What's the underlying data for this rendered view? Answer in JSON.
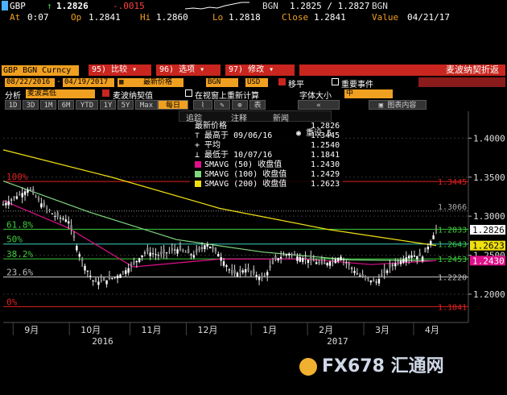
{
  "quote": {
    "ticker": "GBP",
    "arrow": "↑",
    "last": "1.2826",
    "change": "-.0015",
    "source_label": "BGN",
    "bid_ask": "1.2825 / 1.2827",
    "source_label2": "BGN",
    "at_label": "At",
    "at_value": "0:07",
    "op_label": "Op",
    "op_value": "1.2841",
    "hi_label": "Hi",
    "hi_value": "1.2860",
    "lo_label": "Lo",
    "lo_value": "1.2818",
    "close_label": "Close",
    "close_value": "1.2841",
    "value_label": "Value",
    "value_date": "04/21/17"
  },
  "menubar": {
    "security": "GBP BGN Curncy",
    "compare_num": "95)",
    "compare_label": "比较",
    "options_num": "96)",
    "options_label": "选项",
    "edit_num": "97)",
    "edit_label": "修改",
    "title_right": "麦波纳契折返"
  },
  "params": {
    "start_date": "08/22/2016",
    "end_date": "04/19/2017",
    "price_type": "最新价格",
    "source": "BGN",
    "currency": "USD",
    "move_label": "移平",
    "events_label": "重要事件"
  },
  "analysis": {
    "label": "分析",
    "mode": "麦波高低",
    "fib_label": "麦波纳契值",
    "recalc_label": "在视窗上重新计算",
    "font_label": "字体大小",
    "font_value": "中",
    "chart_content": "图表内容"
  },
  "periods": [
    "1D",
    "3D",
    "1M",
    "6M",
    "YTD",
    "1Y",
    "5Y",
    "Max"
  ],
  "interval": "每日",
  "toolbar": {
    "collapse": "«",
    "table_label": "表"
  },
  "overlay_menu": {
    "left": "追踪",
    "middle": "注释",
    "right": "新闻"
  },
  "legend": {
    "last_label": "最新价格",
    "last_value": "1.2826",
    "high_label": "最高于 09/06/16",
    "high_value": "1.3445",
    "avg_label": "平均",
    "avg_value": "1.2540",
    "low_label": "最低于 10/07/16",
    "low_value": "1.1841",
    "sma50_label": "SMAVG (50) 收盘值",
    "sma50_value": "1.2430",
    "sma100_label": "SMAVG (100) 收盘值",
    "sma100_value": "1.2429",
    "sma200_label": "SMAVG (200) 收盘值",
    "sma200_value": "1.2623",
    "reset_label": "重设 5"
  },
  "fib_levels": [
    {
      "label": "100%",
      "value": "1.3445"
    },
    {
      "label": "61.8%",
      "value": "1.2833"
    },
    {
      "label": "50%",
      "value": "1.2643"
    },
    {
      "label": "38.2%",
      "value": "1.2453"
    },
    {
      "label": "23.6%",
      "value": "1.2220"
    },
    {
      "label": "0%",
      "value": "1.1841"
    }
  ],
  "y_ticks": [
    "1.4000",
    "1.3500",
    "1.3000",
    "1.2500",
    "1.2000"
  ],
  "right_labels": {
    "avg_marker": "1.3066",
    "last_price": "1.2826",
    "sma200": "1.2623",
    "sma50": "1.2430"
  },
  "x_axis": {
    "months": [
      "9月",
      "10月",
      "11月",
      "12月",
      "1月",
      "2月",
      "3月",
      "4月"
    ],
    "years": [
      "2016",
      "2017"
    ]
  },
  "watermark": "FX678 汇通网",
  "colors": {
    "sma50": "#e0108a",
    "sma100": "#7fd87f",
    "sma200": "#f0e010",
    "fib_red": "#e02020",
    "candle": "#ffffff",
    "accent": "#f0a020"
  },
  "chart_data": {
    "type": "line",
    "title": "",
    "xlabel": "",
    "ylabel": "",
    "ylim": [
      1.17,
      1.42
    ],
    "x_start": "08/22/2016",
    "x_end": "04/19/2017",
    "series": [
      {
        "name": "SMAVG (200) 收盘值",
        "x": [
          0,
          0.25,
          0.5,
          0.75,
          1.0
        ],
        "values": [
          1.385,
          1.35,
          1.31,
          1.283,
          1.2623
        ]
      },
      {
        "name": "SMAVG (100) 收盘值",
        "x": [
          0,
          0.2,
          0.4,
          0.6,
          0.8,
          1.0
        ],
        "values": [
          1.345,
          1.305,
          1.27,
          1.254,
          1.244,
          1.2429
        ]
      },
      {
        "name": "SMAVG (50) 收盘值",
        "x": [
          0,
          0.15,
          0.3,
          0.5,
          0.7,
          0.85,
          1.0
        ],
        "values": [
          1.32,
          1.285,
          1.235,
          1.245,
          1.245,
          1.238,
          1.243
        ]
      }
    ],
    "price_path": {
      "x": [
        0,
        0.03,
        0.06,
        0.09,
        0.12,
        0.15,
        0.18,
        0.21,
        0.24,
        0.27,
        0.3,
        0.33,
        0.36,
        0.4,
        0.44,
        0.47,
        0.5,
        0.53,
        0.56,
        0.6,
        0.63,
        0.66,
        0.7,
        0.74,
        0.78,
        0.82,
        0.86,
        0.9,
        0.94,
        0.97,
        1.0
      ],
      "values": [
        1.315,
        1.325,
        1.335,
        1.315,
        1.3,
        1.295,
        1.245,
        1.215,
        1.218,
        1.225,
        1.238,
        1.255,
        1.25,
        1.258,
        1.25,
        1.265,
        1.25,
        1.225,
        1.232,
        1.22,
        1.245,
        1.252,
        1.245,
        1.238,
        1.248,
        1.225,
        1.215,
        1.238,
        1.25,
        1.248,
        1.2826
      ]
    }
  }
}
